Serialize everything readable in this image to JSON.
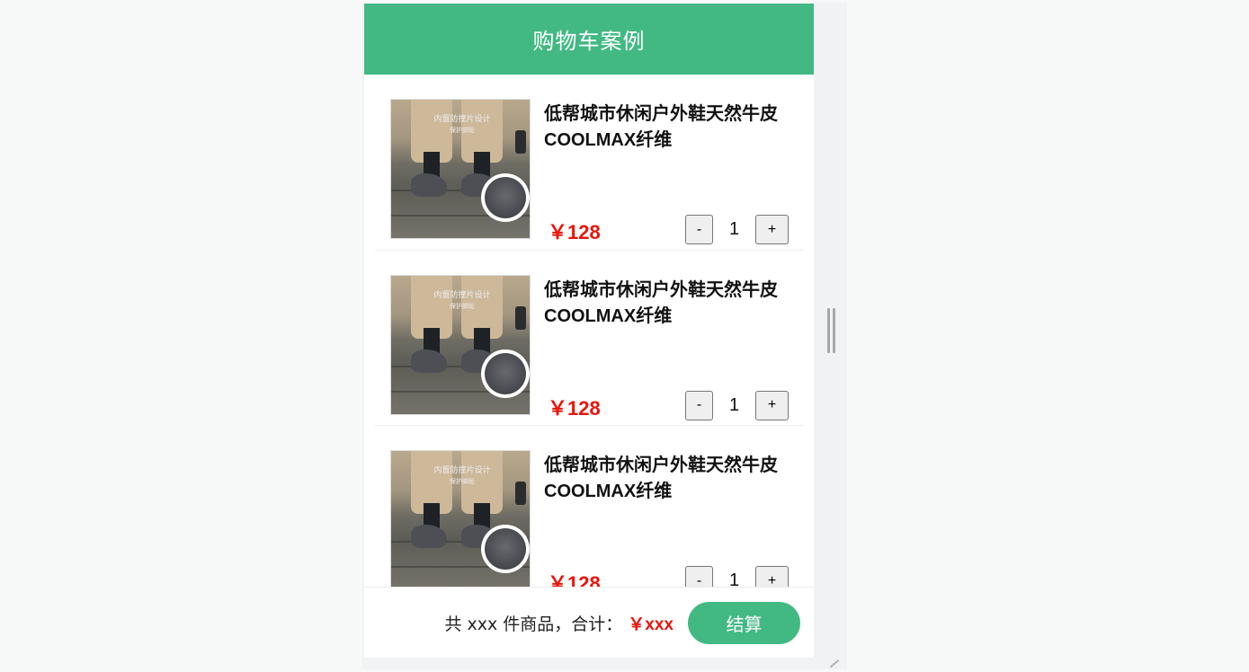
{
  "header": {
    "title": "购物车案例"
  },
  "items": [
    {
      "image_caption": "内置防撞片设计",
      "image_caption_small": "保护脚趾",
      "title": "低帮城市休闲户外鞋天然牛皮COOLMAX纤维",
      "price": "￥128",
      "quantity": "1",
      "minus_label": "-",
      "plus_label": "+"
    },
    {
      "image_caption": "内置防撞片设计",
      "image_caption_small": "保护脚趾",
      "title": "低帮城市休闲户外鞋天然牛皮COOLMAX纤维",
      "price": "￥128",
      "quantity": "1",
      "minus_label": "-",
      "plus_label": "+"
    },
    {
      "image_caption": "内置防撞片设计",
      "image_caption_small": "保护脚趾",
      "title": "低帮城市休闲户外鞋天然牛皮COOLMAX纤维",
      "price": "￥128",
      "quantity": "1",
      "minus_label": "-",
      "plus_label": "+"
    }
  ],
  "footer": {
    "summary": "共 xxx 件商品，合计：",
    "total": "￥xxx",
    "checkout_label": "结算"
  },
  "colors": {
    "accent": "#42b983",
    "price": "#e8150b"
  }
}
